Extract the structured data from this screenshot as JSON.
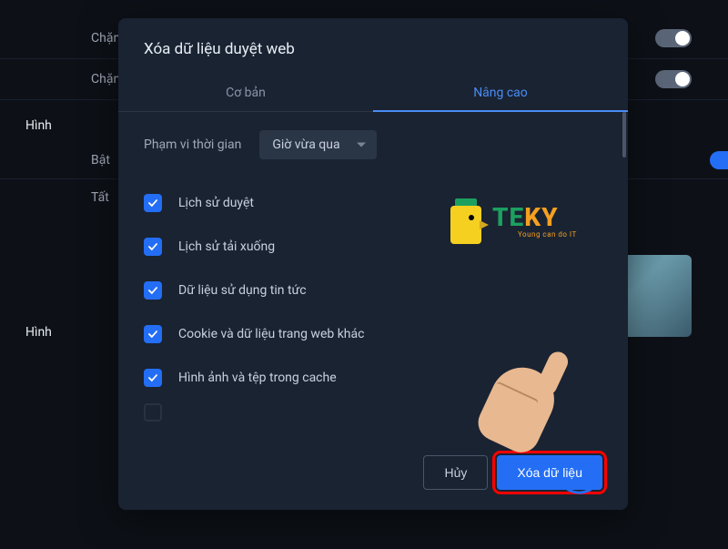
{
  "bg": {
    "row1": "Chặn",
    "row2": "Chặn",
    "section1": "Hình",
    "item1": "Bật",
    "item2": "Tất",
    "section2": "Hình"
  },
  "modal": {
    "title": "Xóa dữ liệu duyệt web",
    "tabs": {
      "basic": "Cơ bản",
      "advanced": "Nâng cao"
    },
    "time_range": {
      "label": "Phạm vi thời gian",
      "selected": "Giờ vừa qua"
    },
    "items": [
      {
        "label": "Lịch sử duyệt",
        "checked": true
      },
      {
        "label": "Lịch sử tải xuống",
        "checked": true
      },
      {
        "label": "Dữ liệu sử dụng tin tức",
        "checked": true
      },
      {
        "label": "Cookie và dữ liệu trang web khác",
        "checked": true
      },
      {
        "label": "Hình ảnh và tệp trong cache",
        "checked": true
      }
    ],
    "buttons": {
      "cancel": "Hủy",
      "confirm": "Xóa dữ liệu"
    }
  },
  "logo": {
    "text_t": "T",
    "text_e": "E",
    "text_k": "K",
    "text_y": "Y",
    "tagline": "Young can do IT"
  }
}
